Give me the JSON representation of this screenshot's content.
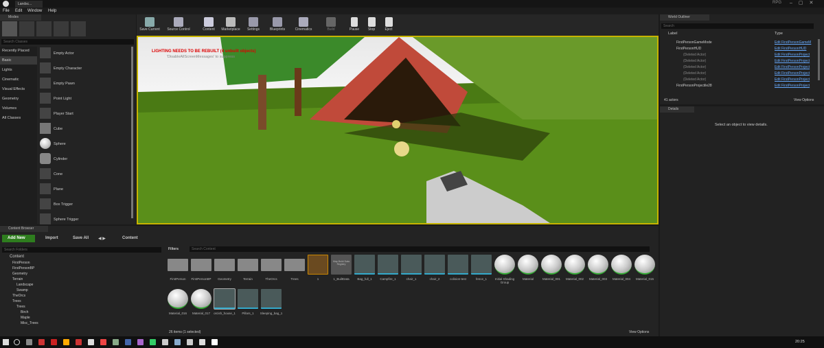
{
  "window": {
    "tab": "Landsc...",
    "rpg": "RPG"
  },
  "menu": [
    "File",
    "Edit",
    "Window",
    "Help"
  ],
  "modes": {
    "tab": "Modes",
    "search_placeholder": "Search Classes",
    "categories": [
      "Recently Placed",
      "Basic",
      "Lights",
      "Cinematic",
      "Visual Effects",
      "Geometry",
      "Volumes",
      "All Classes"
    ],
    "items": [
      "Empty Actor",
      "Empty Character",
      "Empty Pawn",
      "Point Light",
      "Player Start",
      "Cube",
      "Sphere",
      "Cylinder",
      "Cone",
      "Plane",
      "Box Trigger",
      "Sphere Trigger"
    ]
  },
  "toolbar": [
    "Save Current",
    "Source Control",
    "Content",
    "Marketplace",
    "Settings",
    "Blueprints",
    "Cinematics",
    "Build",
    "Pause",
    "Stop",
    "Eject"
  ],
  "viewport": {
    "warning": "LIGHTING NEEDS TO BE REBUILT (4 unbuilt objects)",
    "warning2": "'DisableAllScreenMessages' to suppress"
  },
  "outliner": {
    "tab": "World Outliner",
    "search_placeholder": "Search",
    "col_label": "Label",
    "col_type": "Type",
    "rows": [
      {
        "label": "FirstPersonGameMode",
        "type": "Edit FirstPersonGameM"
      },
      {
        "label": "FirstPersonHUD",
        "type": "Edit FirstPersonHUD"
      },
      {
        "label": "(Deleted Actor)",
        "type": "Edit FirstPersonProject"
      },
      {
        "label": "(Deleted Actor)",
        "type": "Edit FirstPersonProject"
      },
      {
        "label": "(Deleted Actor)",
        "type": "Edit FirstPersonProject"
      },
      {
        "label": "(Deleted Actor)",
        "type": "Edit FirstPersonProject"
      },
      {
        "label": "(Deleted Actor)",
        "type": "Edit FirstPersonProject"
      },
      {
        "label": "FirstPersonProjectile28",
        "type": "Edit FirstPersonProject"
      }
    ],
    "count": "41 actors",
    "view_options": "View Options"
  },
  "details": {
    "tab": "Details",
    "empty": "Select an object to view details."
  },
  "content_browser": {
    "tab": "Content Browser",
    "add_new": "Add New",
    "import": "Import",
    "save_all": "Save All",
    "path": "Content",
    "search_folders": "Search Folders",
    "filters": "Filters",
    "search_content": "Search Content",
    "tree": [
      "Content",
      "FirstPerson",
      "FirstPersonBP",
      "Geometry",
      "Terrain",
      "Landscape",
      "Swamp",
      "TheOrcs",
      "Trees",
      "Trees",
      "Birch",
      "Maple",
      "Misc_Trees"
    ],
    "assets_row1": [
      "FirstPerson",
      "FirstPersonBP",
      "Geometry",
      "Terrain",
      "TheOrcs",
      "Trees",
      "1",
      "1_BuiltData",
      "Bag_full_1",
      "Campfire_1",
      "chair_1",
      "chair_2",
      "colision-test",
      "fence_1",
      "Initial Shading Group",
      "Material",
      "Material_001",
      "Material_002",
      "Material_003",
      "Material_004",
      "Material_015"
    ],
    "assets_row2": [
      "Material_016",
      "Material_017",
      "orcish_house_1",
      "Pillars_1",
      "Sleeping_bag_1"
    ],
    "builtdata_thumb": "Map Build Data Registry",
    "status": "26 items (1 selected)",
    "view_options": "View Options"
  },
  "clock": "20:25"
}
